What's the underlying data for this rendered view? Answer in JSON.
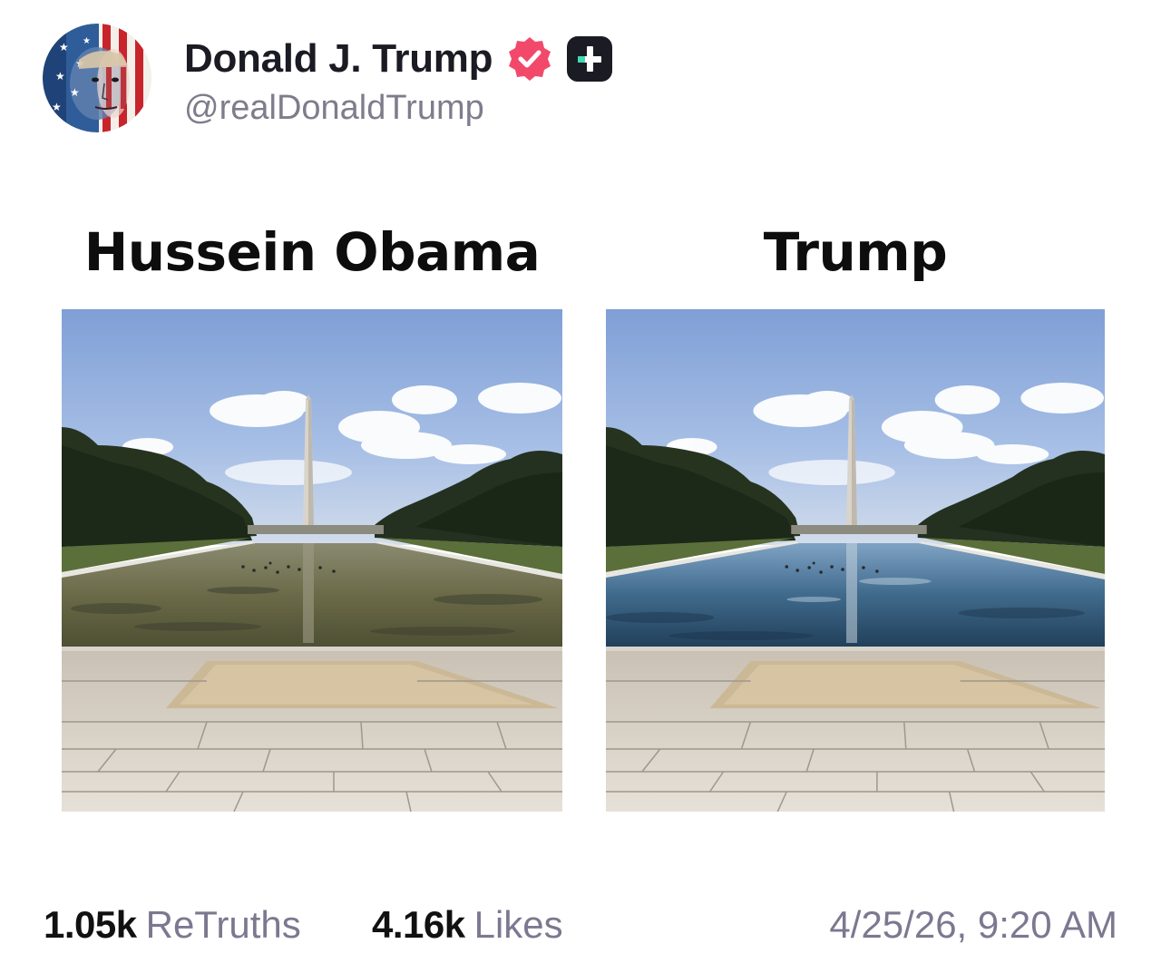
{
  "post": {
    "author": {
      "display_name": "Donald J. Trump",
      "handle": "@realDonaldTrump",
      "verified_icon": "verified-badge-icon",
      "plus_icon": "truth-plus-icon",
      "avatar": "avatar-flag-portrait"
    },
    "image": {
      "left_caption": "Hussein Obama",
      "right_caption": "Trump"
    },
    "stats": {
      "retruths_count": "1.05k",
      "retruths_label": "ReTruths",
      "likes_count": "4.16k",
      "likes_label": "Likes"
    },
    "timestamp": "4/25/26, 9:20 AM"
  },
  "colors": {
    "verified": "#f2496b",
    "plus_badge_bg": "#1b1b24",
    "plus_badge_accent": "#3ddcb5",
    "muted_text": "#7c7890",
    "murky_water": "#6b6a48",
    "clean_water": "#3f6a8c"
  }
}
